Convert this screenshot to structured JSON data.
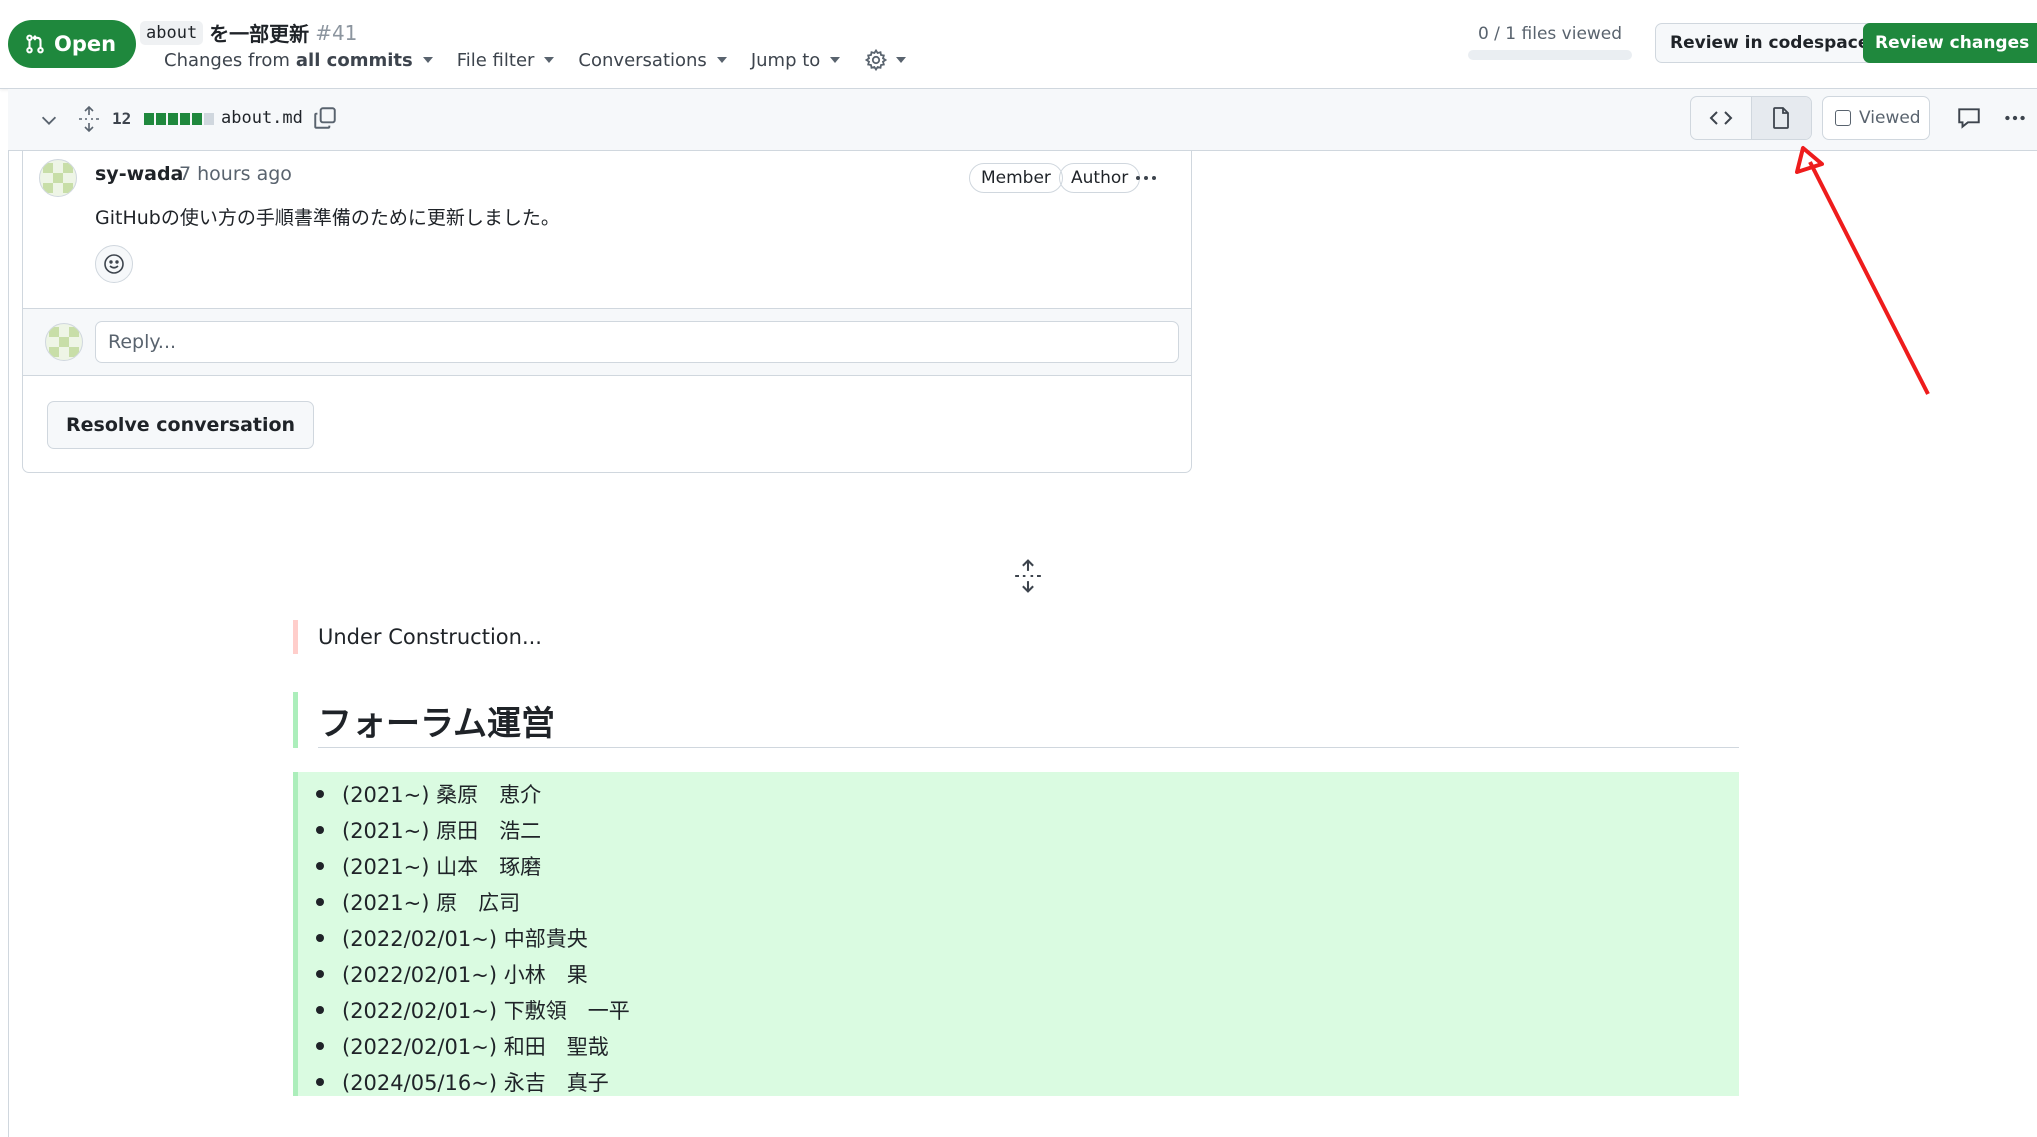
{
  "header": {
    "status_label": "Open",
    "title_code": "about",
    "title_text": "を一部更新",
    "pr_number": "#41",
    "changes_prefix": "Changes from",
    "changes_value": "all commits",
    "file_filter": "File filter",
    "conversations": "Conversations",
    "jump_to": "Jump to",
    "files_viewed": "0 / 1 files viewed",
    "review_codespace": "Review in codespace",
    "review_changes": "Review changes",
    "accent_color": "#1f883d"
  },
  "file": {
    "change_count": "12",
    "diff_blocks": {
      "added": 5,
      "neutral": 1
    },
    "filename": "about.md",
    "viewed_label": "Viewed",
    "view_mode": "rich-diff"
  },
  "comment": {
    "author": "sy-wada",
    "time": "7 hours ago",
    "labels": [
      "Member",
      "Author"
    ],
    "body": "GitHubの使い方の手順書準備のために更新しました。",
    "reply_placeholder": "Reply...",
    "resolve_label": "Resolve conversation"
  },
  "markdown": {
    "deleted_line": "Under Construction...",
    "heading": "フォーラム運営",
    "list": [
      "(2021~) 桑原　恵介",
      "(2021~) 原田　浩二",
      "(2021~) 山本　琢磨",
      "(2021~) 原　広司",
      "(2022/02/01~) 中部貴央",
      "(2022/02/01~) 小林　果",
      "(2022/02/01~) 下敷領　一平",
      "(2022/02/01~) 和田　聖哉",
      "(2024/05/16~) 永吉　真子"
    ]
  },
  "colors": {
    "added_bg": "#dafbe1",
    "added_border": "#aceebb",
    "deleted_border": "#ffcecb",
    "annotation_arrow": "#ee1c1c"
  },
  "icons": [
    "git-pull-request-icon",
    "gear-icon",
    "chevron-down-icon",
    "unfold-icon",
    "copy-icon",
    "code-icon",
    "file-icon",
    "comment-icon",
    "kebab-horizontal-icon",
    "smiley-icon"
  ]
}
